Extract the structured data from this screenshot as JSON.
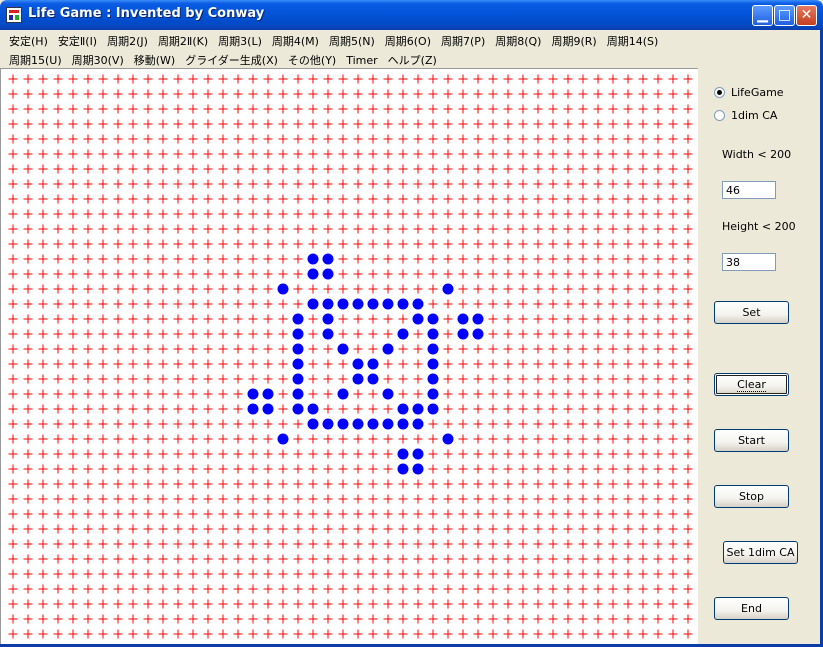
{
  "window": {
    "title": "Life Game : Invented by Conway"
  },
  "titlebar_buttons": [
    {
      "name": "minimize-button",
      "glyph": "▁"
    },
    {
      "name": "maximize-button",
      "glyph": "□"
    },
    {
      "name": "close-button",
      "glyph": "✕"
    }
  ],
  "menu": {
    "row1": [
      "安定(H)",
      "安定Ⅱ(I)",
      "周期2(J)",
      "周期2Ⅱ(K)",
      "周期3(L)",
      "周期4(M)",
      "周期5(N)",
      "周期6(O)",
      "周期7(P)",
      "周期8(Q)",
      "周期9(R)",
      "周期14(S)"
    ],
    "row2": [
      "周期15(U)",
      "周期30(V)",
      "移動(W)",
      "グライダー生成(X)",
      "その他(Y)",
      "Timer",
      "ヘルプ(Z)"
    ]
  },
  "board": {
    "columns": 46,
    "rows": 38,
    "dead_color": "#ff0000",
    "live_color": "#0000ff",
    "live_cells": [
      [
        20,
        12
      ],
      [
        21,
        12
      ],
      [
        20,
        13
      ],
      [
        21,
        13
      ],
      [
        18,
        14
      ],
      [
        29,
        14
      ],
      [
        20,
        15
      ],
      [
        21,
        15
      ],
      [
        22,
        15
      ],
      [
        23,
        15
      ],
      [
        24,
        15
      ],
      [
        25,
        15
      ],
      [
        26,
        15
      ],
      [
        27,
        15
      ],
      [
        19,
        16
      ],
      [
        21,
        16
      ],
      [
        27,
        16
      ],
      [
        28,
        16
      ],
      [
        30,
        16
      ],
      [
        31,
        16
      ],
      [
        19,
        17
      ],
      [
        21,
        17
      ],
      [
        26,
        17
      ],
      [
        28,
        17
      ],
      [
        30,
        17
      ],
      [
        31,
        17
      ],
      [
        19,
        18
      ],
      [
        22,
        18
      ],
      [
        25,
        18
      ],
      [
        28,
        18
      ],
      [
        19,
        19
      ],
      [
        23,
        19
      ],
      [
        24,
        19
      ],
      [
        28,
        19
      ],
      [
        19,
        20
      ],
      [
        23,
        20
      ],
      [
        24,
        20
      ],
      [
        28,
        20
      ],
      [
        16,
        21
      ],
      [
        17,
        21
      ],
      [
        19,
        21
      ],
      [
        22,
        21
      ],
      [
        25,
        21
      ],
      [
        28,
        21
      ],
      [
        16,
        22
      ],
      [
        17,
        22
      ],
      [
        19,
        22
      ],
      [
        20,
        22
      ],
      [
        26,
        22
      ],
      [
        27,
        22
      ],
      [
        28,
        22
      ],
      [
        20,
        23
      ],
      [
        21,
        23
      ],
      [
        22,
        23
      ],
      [
        23,
        23
      ],
      [
        24,
        23
      ],
      [
        25,
        23
      ],
      [
        26,
        23
      ],
      [
        27,
        23
      ],
      [
        18,
        24
      ],
      [
        29,
        24
      ],
      [
        26,
        25
      ],
      [
        27,
        25
      ],
      [
        26,
        26
      ],
      [
        27,
        26
      ]
    ]
  },
  "panel": {
    "mode_options": [
      {
        "label": "LifeGame",
        "selected": true
      },
      {
        "label": "1dim CA",
        "selected": false
      }
    ],
    "width_label": "Width < 200",
    "width_value": "46",
    "height_label": "Height < 200",
    "height_value": "38",
    "buttons": {
      "set": "Set",
      "clear": "Clear",
      "start": "Start",
      "stop": "Stop",
      "set1dim": "Set 1dim CA",
      "end": "End"
    }
  }
}
